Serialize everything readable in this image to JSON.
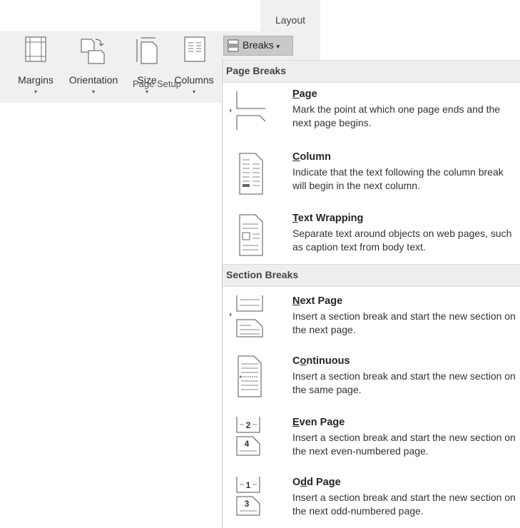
{
  "tab": {
    "label": "Layout"
  },
  "ribbon": {
    "buttons": [
      {
        "label": "Margins",
        "icon": "margins-icon"
      },
      {
        "label": "Orientation",
        "icon": "orientation-icon"
      },
      {
        "label": "Size",
        "icon": "size-icon"
      },
      {
        "label": "Columns",
        "icon": "columns-icon"
      }
    ],
    "dropdown_arrow": "▾",
    "group_label": "Page Setup",
    "breaks_label": "Breaks"
  },
  "menu": {
    "page_breaks_header": "Page Breaks",
    "section_breaks_header": "Section Breaks",
    "items": [
      {
        "accel": "P",
        "rest": "age",
        "desc": "Mark the point at which one page ends and the next page begins.",
        "icon": "page-break-icon"
      },
      {
        "accel": "C",
        "rest": "olumn",
        "desc": "Indicate that the text following the column break will begin in the next column.",
        "icon": "column-break-icon"
      },
      {
        "accel": "T",
        "rest": "ext Wrapping",
        "desc": "Separate text around objects on web pages, such as caption text from body text.",
        "icon": "text-wrapping-icon"
      },
      {
        "accel": "N",
        "rest": "ext Page",
        "desc": "Insert a section break and start the new section on the next page.",
        "icon": "next-page-icon"
      },
      {
        "pre": "C",
        "accel": "o",
        "rest": "ntinuous",
        "desc": "Insert a section break and start the new section on the same page.",
        "icon": "continuous-icon"
      },
      {
        "accel": "E",
        "rest": "ven Page",
        "desc": "Insert a section break and start the new section on the next even-numbered page.",
        "icon": "even-page-icon"
      },
      {
        "pre": "O",
        "accel": "d",
        "rest": "d Page",
        "desc": "Insert a section break and start the new section on the next odd-numbered page.",
        "icon": "odd-page-icon"
      }
    ],
    "even_numbers": [
      "2",
      "4"
    ],
    "odd_numbers": [
      "1",
      "3"
    ]
  }
}
